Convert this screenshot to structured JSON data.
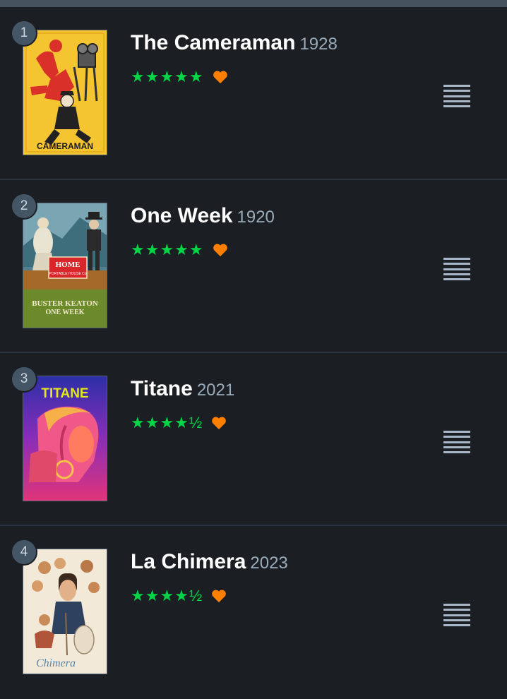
{
  "colors": {
    "background": "#1b1e23",
    "star_green": "#00d447",
    "heart_orange": "#ff8000",
    "year_grey": "#9aabba",
    "divider": "#2c3440"
  },
  "films": [
    {
      "rank": "1",
      "title": "The Cameraman",
      "year": "1928",
      "stars": "★★★★★",
      "rating": 5,
      "liked": true,
      "poster_text": "CAMERAMAN",
      "menu_icon": "drag-handle-icon"
    },
    {
      "rank": "2",
      "title": "One Week",
      "year": "1920",
      "stars": "★★★★★",
      "rating": 5,
      "liked": true,
      "poster_text_home": "HOME",
      "poster_text_home_sub": "PORTABLE HOUSE Co",
      "poster_text_name": "BUSTER KEATON",
      "poster_text_title": "ONE WEEK",
      "menu_icon": "drag-handle-icon"
    },
    {
      "rank": "3",
      "title": "Titane",
      "year": "2021",
      "stars": "★★★★½",
      "rating": 4.5,
      "liked": true,
      "poster_text": "TITANE",
      "menu_icon": "drag-handle-icon"
    },
    {
      "rank": "4",
      "title": "La Chimera",
      "year": "2023",
      "stars": "★★★★½",
      "rating": 4.5,
      "liked": true,
      "poster_text": "Chimera",
      "menu_icon": "drag-handle-icon"
    }
  ]
}
